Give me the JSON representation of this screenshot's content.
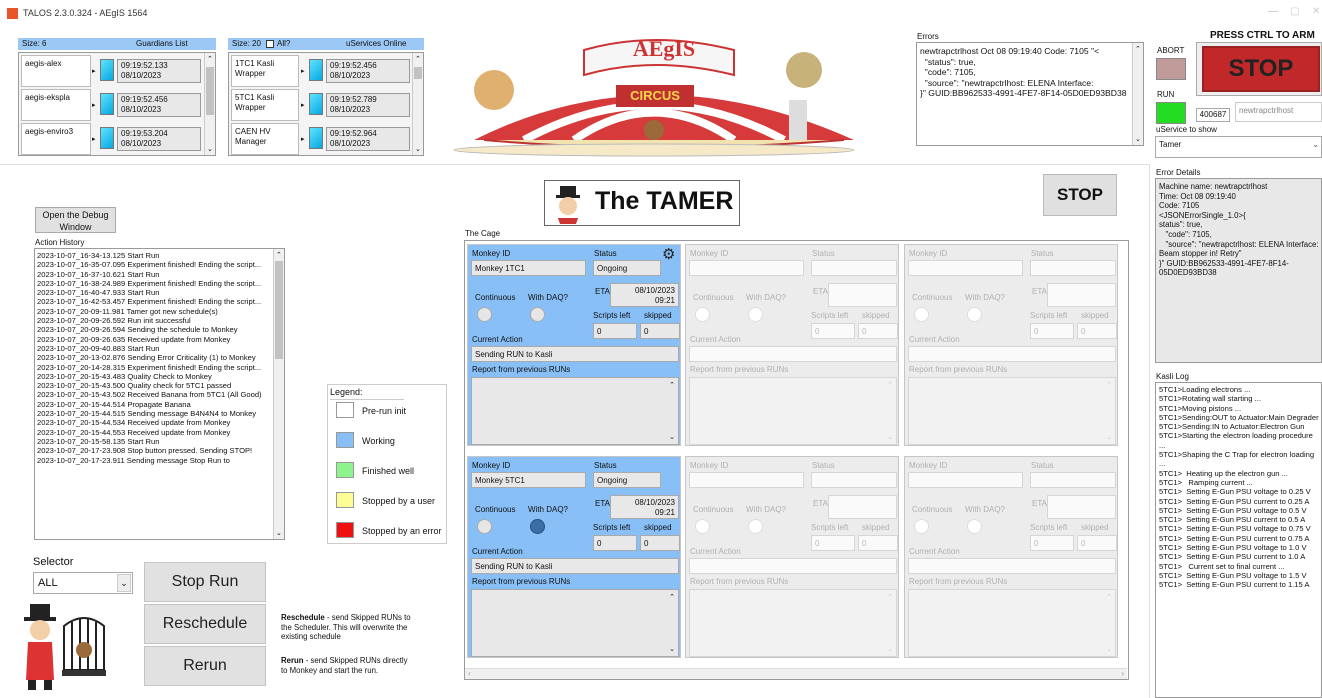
{
  "app": {
    "title": "TALOS 2.3.0.324 - AEgIS 1564"
  },
  "guardians": {
    "size_label": "Size: 6",
    "title": "Guardians List",
    "rows": [
      {
        "name": "aegis-alex",
        "time": "09:19:52.133",
        "date": "08/10/2023"
      },
      {
        "name": "aegis-ekspla",
        "time": "09:19:52.456",
        "date": "08/10/2023"
      },
      {
        "name": "aegis-enviro3",
        "time": "09:19:53.204",
        "date": "08/10/2023"
      }
    ]
  },
  "uservices": {
    "size_label": "Size: 20",
    "all_label": "All?",
    "title": "uServices Online",
    "rows": [
      {
        "name": "1TC1 Kasli Wrapper",
        "time": "09:19:52.456",
        "date": "08/10/2023"
      },
      {
        "name": "5TC1 Kasli Wrapper",
        "time": "09:19:52.789",
        "date": "08/10/2023"
      },
      {
        "name": "CAEN HV Manager",
        "time": "09:19:52.964",
        "date": "08/10/2023"
      }
    ]
  },
  "banner": {
    "logo_text": "AEgIS",
    "circus_text": "CIRCUS"
  },
  "errors": {
    "title": "Errors",
    "text": "newtrapctrlhost Oct 08 09:19:40 Code: 7105 \"<\n  \"status\": true,\n  \"code\": 7105,\n  \"source\": \"newtrapctrlhost: ELENA Interface:\n}\" GUID:BB962533-4991-4FE7-8F14-05D0ED93BD38"
  },
  "controls": {
    "press_ctrl": "PRESS CTRL TO ARM",
    "abort_label": "ABORT",
    "stop_label": "STOP",
    "run_label": "RUN",
    "run_number": "400687",
    "host": "newtrapctrlhost",
    "uservice_label": "uService to show",
    "uservice_value": "Tamer"
  },
  "error_details": {
    "title": "Error Details",
    "text": "Machine name: newtrapctrlhost\nTime: Oct 08 09:19:40\nCode: 7105\n<JSONErrorSingle_1.0>{\nstatus\": true,\n   \"code\": 7105,\n   \"source\": \"newtrapctrlhost: ELENA Interface: Beam stopper in! Retry\"\n}\" GUID:BB962533-4991-4FE7-8F14-05D0ED93BD38"
  },
  "kasli_log": {
    "title": "Kasli Log",
    "text": "5TC1>Loading electrons ...\n5TC1>Rotating wall starting ...\n5TC1>Moving pistons ...\n5TC1>Sending:OUT to Actuator:Main Degrader\n5TC1>Sending:IN to Actuator:Electron Gun\n5TC1>Starting the electron loading procedure ...\n5TC1>Shaping the C Trap for electron loading ...\n5TC1>  Heating up the electron gun ...\n5TC1>   Ramping current ...\n5TC1>  Setting E-Gun PSU voltage to 0.25 V\n5TC1>  Setting E-Gun PSU current to 0.25 A\n5TC1>  Setting E-Gun PSU voltage to 0.5 V\n5TC1>  Setting E-Gun PSU current to 0.5 A\n5TC1>  Setting E-Gun PSU voltage to 0.75 V\n5TC1>  Setting E-Gun PSU current to 0.75 A\n5TC1>  Setting E-Gun PSU voltage to 1.0 V\n5TC1>  Setting E-Gun PSU current to 1.0 A\n5TC1>   Current set to final current ...\n5TC1>  Setting E-Gun PSU voltage to 1.5 V\n5TC1>  Setting E-Gun PSU current to 1.15 A"
  },
  "tamer": {
    "title": "The TAMER",
    "stop_label": "STOP",
    "debug_button": "Open the Debug Window",
    "action_history_title": "Action History",
    "action_history": "2023-10-07_16-34-13.125 Start Run\n2023-10-07_16-35-07.095 Experiment finished! Ending the script...\n2023-10-07_16-37-10.621 Start Run\n2023-10-07_16-38-24.989 Experiment finished! Ending the script...\n2023-10-07_16-40-47.933 Start Run\n2023-10-07_16-42-53.457 Experiment finished! Ending the script...\n2023-10-07_20-09-11.981 Tamer got new schedule(s)\n2023-10-07_20-09-26.592 Run init successful\n2023-10-07_20-09-26.594 Sending the schedule to Monkey\n2023-10-07_20-09-26.635 Received update from Monkey\n2023-10-07_20-09-40.883 Start Run\n2023-10-07_20-13-02.876 Sending Error Criticality (1) to Monkey\n2023-10-07_20-14-28.315 Experiment finished! Ending the script...\n2023-10-07_20-15-43.483 Quality Check to Monkey\n2023-10-07_20-15-43.500 Quality check for 5TC1 passed\n2023-10-07_20-15-43.502 Received Banana from 5TC1 (All Good)\n2023-10-07_20-15-44.514 Propagate Banana\n2023-10-07_20-15-44.515 Sending message B4N4N4 to Monkey\n2023-10-07_20-15-44.534 Received update from Monkey\n2023-10-07_20-15-44.553 Received update from Monkey\n2023-10-07_20-15-58.135 Start Run\n2023-10-07_20-17-23.908 Stop button pressed. Sending STOP!\n2023-10-07_20-17-23.911 Sending message Stop Run to",
    "legend_title": "Legend:",
    "legend": [
      {
        "label": "Pre-run init",
        "color": "#ffffff"
      },
      {
        "label": "Working",
        "color": "#88bff6"
      },
      {
        "label": "Finished well",
        "color": "#8ef28e"
      },
      {
        "label": "Stopped by a user",
        "color": "#fdfd96"
      },
      {
        "label": "Stopped by an error",
        "color": "#ee1111"
      }
    ],
    "selector_label": "Selector",
    "selector_value": "ALL",
    "stop_run": "Stop Run",
    "reschedule": "Reschedule",
    "rerun": "Rerun",
    "reschedule_bold": "Reschedule",
    "reschedule_desc": " - send Skipped RUNs to the Scheduler. This will overwrite the existing schedule",
    "rerun_bold": "Rerun",
    "rerun_desc": " - send Skipped RUNs directly to Monkey and start the run.",
    "cage_label": "The Cage"
  },
  "cage_labels": {
    "monkey_id": "Monkey ID",
    "status": "Status",
    "continuous": "Continuous",
    "with_daq": "With DAQ?",
    "eta": "ETA",
    "scripts_left": "Scripts left",
    "skipped": "skipped",
    "current_action": "Current Action",
    "report": "Report from previous RUNs"
  },
  "cards": [
    {
      "monkey": "Monkey 1TC1",
      "status": "Ongoing",
      "eta_date": "08/10/2023",
      "eta_time": "09:21",
      "scripts_left": "0",
      "skipped": "0",
      "action": "Sending RUN to Kasli"
    },
    {
      "monkey": "Monkey 5TC1",
      "status": "Ongoing",
      "eta_date": "08/10/2023",
      "eta_time": "09:21",
      "scripts_left": "0",
      "skipped": "0",
      "action": "Sending RUN to Kasli"
    },
    {
      "idle_value": "0"
    }
  ]
}
